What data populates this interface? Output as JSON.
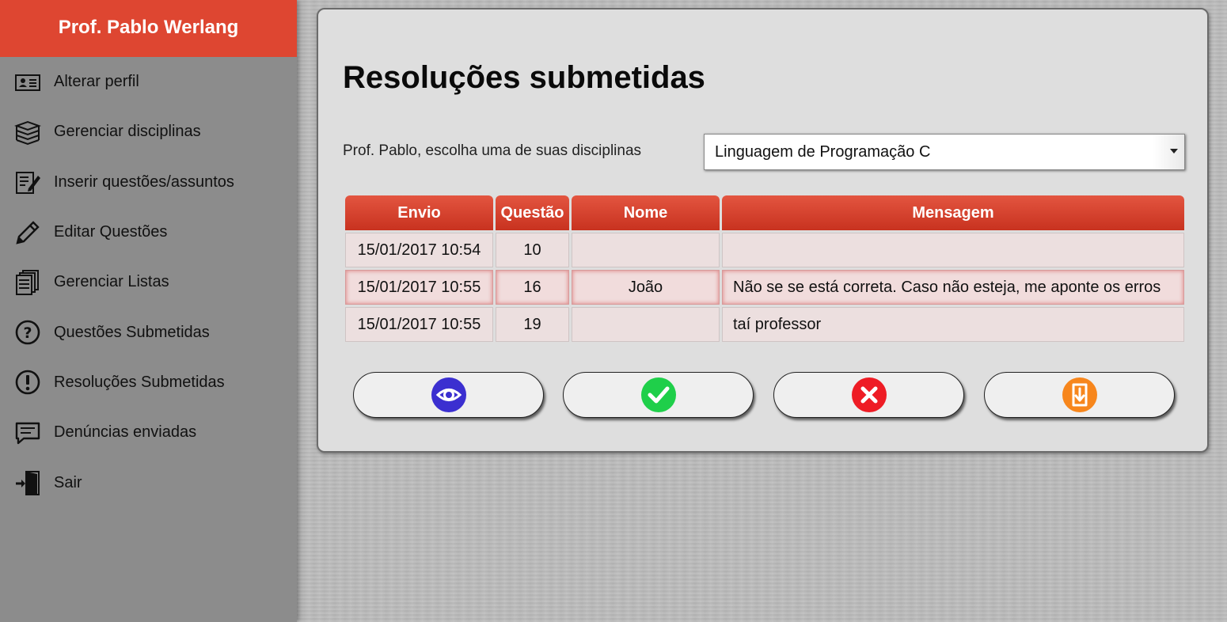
{
  "sidebar": {
    "header": "Prof. Pablo Werlang",
    "items": [
      {
        "label": "Alterar perfil",
        "icon": "id-card-icon"
      },
      {
        "label": "Gerenciar disciplinas",
        "icon": "books-stack-icon"
      },
      {
        "label": "Inserir questões/assuntos",
        "icon": "edit-document-icon"
      },
      {
        "label": "Editar Questões",
        "icon": "pencil-icon"
      },
      {
        "label": "Gerenciar Listas",
        "icon": "documents-stack-icon"
      },
      {
        "label": "Questões Submetidas",
        "icon": "question-circle-icon"
      },
      {
        "label": "Resoluções Submetidas",
        "icon": "exclamation-circle-icon"
      },
      {
        "label": "Denúncias enviadas",
        "icon": "message-bubble-icon"
      },
      {
        "label": "Sair",
        "icon": "exit-door-icon"
      }
    ]
  },
  "main": {
    "title": "Resoluções submetidas",
    "choose_label": "Prof. Pablo, escolha uma de suas disciplinas",
    "selected_discipline": "Linguagem de Programação C",
    "table": {
      "headers": [
        "Envio",
        "Questão",
        "Nome",
        "Mensagem"
      ],
      "rows": [
        {
          "envio": "15/01/2017 10:54",
          "questao": "10",
          "nome": "",
          "mensagem": ""
        },
        {
          "envio": "15/01/2017 10:55",
          "questao": "16",
          "nome": "João",
          "mensagem": "Não se se está correta. Caso não esteja, me aponte os erros"
        },
        {
          "envio": "15/01/2017 10:55",
          "questao": "19",
          "nome": "",
          "mensagem": "taí professor"
        }
      ]
    },
    "actions": [
      {
        "icon": "eye-icon",
        "color": "#3b2fd0"
      },
      {
        "icon": "check-icon",
        "color": "#1fcf4a"
      },
      {
        "icon": "close-icon",
        "color": "#ee1c25"
      },
      {
        "icon": "download-document-icon",
        "color": "#f7861c"
      }
    ]
  },
  "colors": {
    "accent": "#de4631",
    "sidebar_bg": "#8c8c8c",
    "panel_bg": "#dedede"
  }
}
